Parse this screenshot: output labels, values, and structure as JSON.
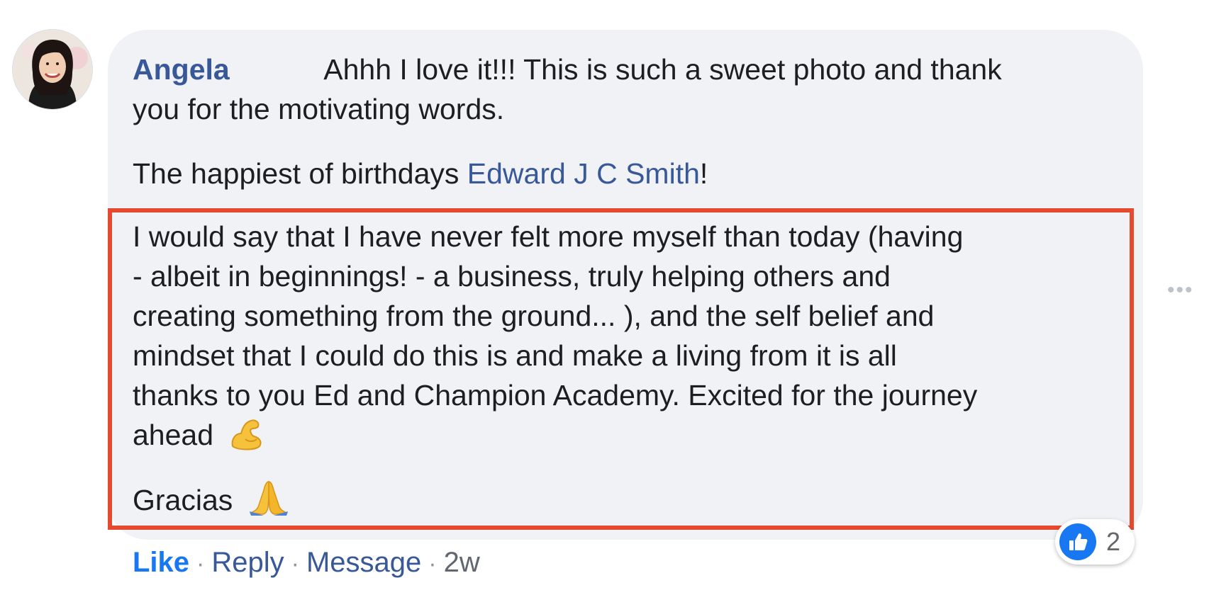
{
  "comment": {
    "author": "Angela",
    "paragraph1": {
      "line1": "Ahhh I love it!!! This is such a sweet photo and thank",
      "line2": "you for the motivating words."
    },
    "paragraph2": {
      "before": "The happiest of birthdays ",
      "mention": "Edward J C Smith",
      "after": "!"
    },
    "highlighted": {
      "lines": [
        "I would say that I have never felt more myself than today (having",
        "- albeit in beginnings! - a business, truly helping others and",
        "creating something from the ground... ), and the self belief and",
        "mindset that I could do this is and make a living from it is all",
        "thanks to you Ed and Champion Academy. Excited for the journey",
        "ahead"
      ],
      "closing": "Gracias"
    },
    "actions": {
      "like": "Like",
      "reply": "Reply",
      "message": "Message",
      "time": "2w",
      "separator": "·"
    },
    "reactions": {
      "count": "2",
      "icon": "thumbs-up-icon"
    },
    "more_icon": "more-options-icon"
  },
  "colors": {
    "author_link": "#385898",
    "like_blue": "#1877f2",
    "bubble_bg": "#f0f2f5",
    "highlight_border": "#e64a2e"
  }
}
